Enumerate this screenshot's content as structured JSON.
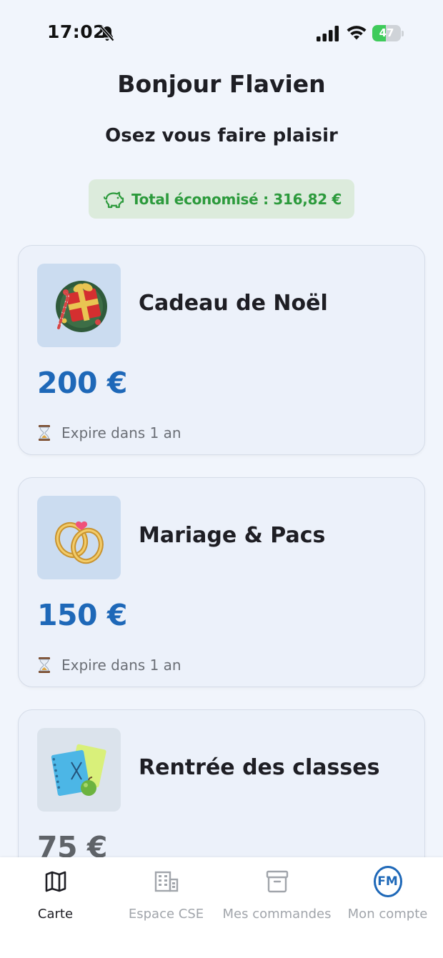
{
  "status_bar": {
    "time": "17:02",
    "battery_percent": "47",
    "battery_level": 0.47,
    "battery_color": "#3fcb5b",
    "icons": [
      "bell-off-icon",
      "signal-icon",
      "wifi-icon",
      "battery-icon"
    ]
  },
  "header": {
    "greeting": "Bonjour Flavien",
    "subtitle": "Osez vous faire plaisir"
  },
  "savings": {
    "label": "Total économisé : 316,82 €",
    "icon": "piggy-bank-icon",
    "color": "#2c9a3c"
  },
  "cards": [
    {
      "title": "Cadeau de Noël",
      "amount": "200 €",
      "expire": "Expire dans 1 an",
      "image": "christmas-gift-image"
    },
    {
      "title": "Mariage & Pacs",
      "amount": "150 €",
      "expire": "Expire dans 1 an",
      "image": "wedding-rings-image"
    },
    {
      "title": "Rentrée des classes",
      "amount": "75 €",
      "expire": "",
      "image": "school-notebooks-image"
    }
  ],
  "nav": {
    "items": [
      {
        "label": "Carte",
        "icon": "map-icon",
        "active": true
      },
      {
        "label": "Espace CSE",
        "icon": "building-icon",
        "active": false
      },
      {
        "label": "Mes commandes",
        "icon": "archive-box-icon",
        "active": false
      },
      {
        "label": "Mon compte",
        "icon": "avatar",
        "initials": "FM",
        "active": false
      }
    ]
  },
  "colors": {
    "accent": "#1e68b8",
    "background": "#f1f5fc",
    "card": "#ecf1fa"
  }
}
